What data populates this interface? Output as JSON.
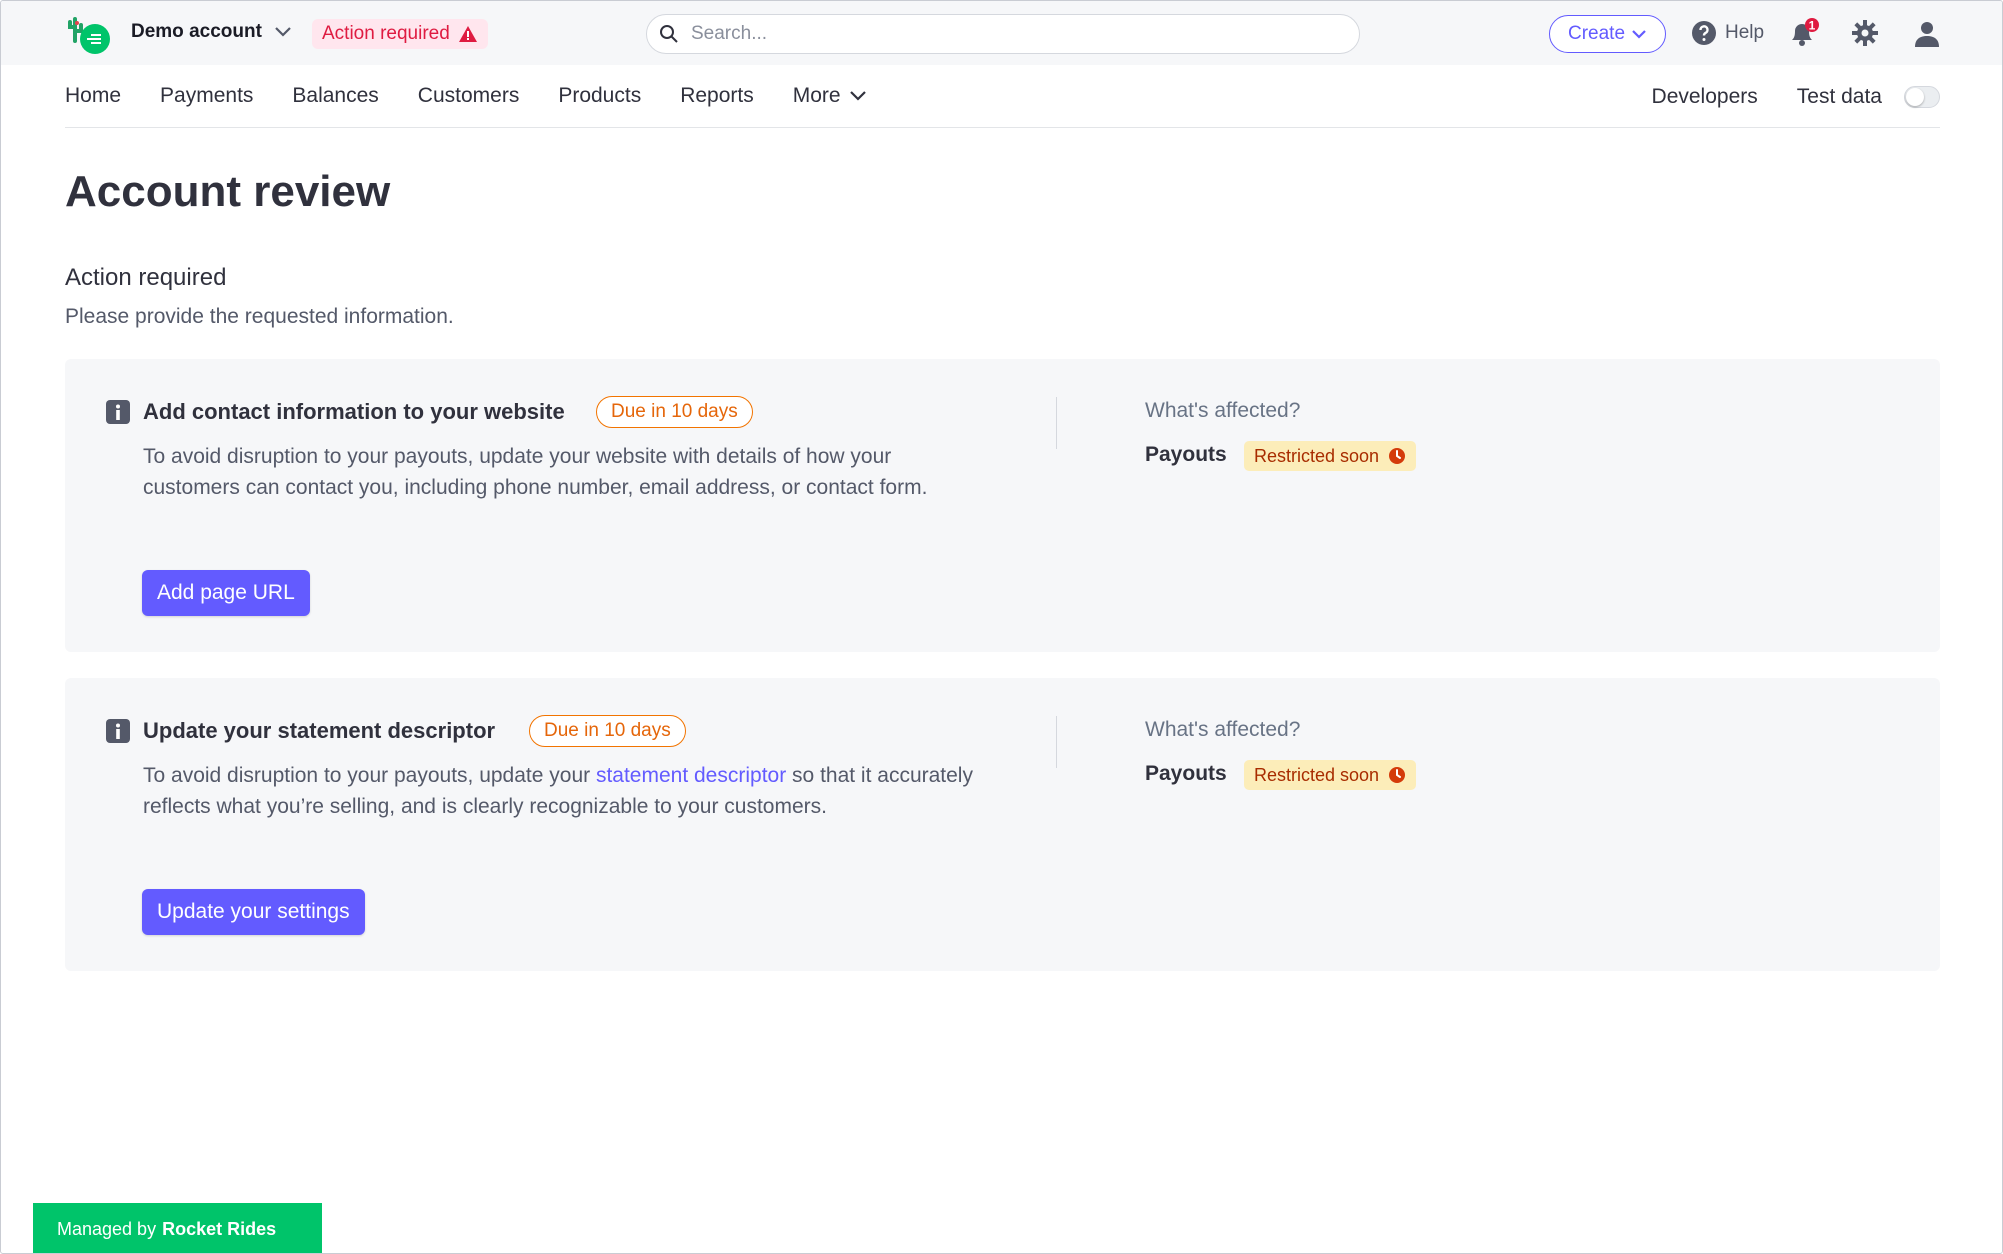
{
  "header": {
    "account_name": "Demo account",
    "action_pill": "Action required",
    "search_placeholder": "Search...",
    "create_label": "Create",
    "help_label": "Help",
    "notification_count": "1"
  },
  "nav": {
    "items": [
      "Home",
      "Payments",
      "Balances",
      "Customers",
      "Products",
      "Reports",
      "More"
    ],
    "developers": "Developers",
    "test_data": "Test data"
  },
  "page": {
    "title": "Account review",
    "section_title": "Action required",
    "section_sub": "Please provide the requested information."
  },
  "cards": [
    {
      "title": "Add contact information to your website",
      "due": "Due in 10 days",
      "body": "To avoid disruption to your payouts, update your website with details of how your customers can contact you, including phone number, email address, or contact form.",
      "button": "Add page URL",
      "affected_label": "What's affected?",
      "affected_item": "Payouts",
      "status": "Restricted soon"
    },
    {
      "title": "Update your statement descriptor",
      "due": "Due in 10 days",
      "body_pre": "To avoid disruption to your payouts, update your ",
      "body_link": "statement descriptor",
      "body_post": " so that it accurately reflects what you’re selling, and is clearly recognizable to your customers.",
      "button": "Update your settings",
      "affected_label": "What's affected?",
      "affected_item": "Payouts",
      "status": "Restricted soon"
    }
  ],
  "footer": {
    "managed_prefix": "Managed by",
    "managed_name": "Rocket Rides"
  },
  "colors": {
    "accent": "#635bff",
    "danger": "#df1b41",
    "warning": "#f27400",
    "success": "#00c46a"
  }
}
